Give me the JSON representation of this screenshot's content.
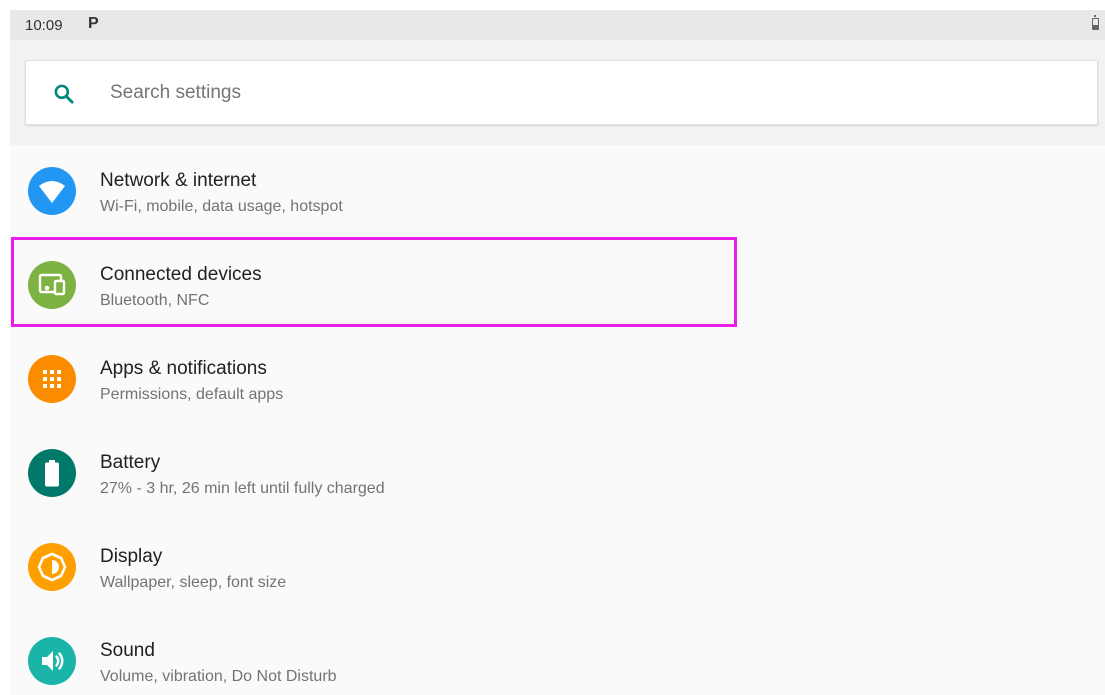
{
  "status_bar": {
    "time": "10:09",
    "notification_glyph": "P"
  },
  "search": {
    "placeholder": "Search settings"
  },
  "settings": [
    {
      "title": "Network & internet",
      "subtitle": "Wi-Fi, mobile, data usage, hotspot",
      "icon": "wifi-icon",
      "color": "#2196f3"
    },
    {
      "title": "Connected devices",
      "subtitle": "Bluetooth, NFC",
      "icon": "devices-icon",
      "color": "#7cb342"
    },
    {
      "title": "Apps & notifications",
      "subtitle": "Permissions, default apps",
      "icon": "apps-icon",
      "color": "#fb8c00"
    },
    {
      "title": "Battery",
      "subtitle": "27% - 3 hr, 26 min left until fully charged",
      "icon": "battery-icon",
      "color": "#00796b"
    },
    {
      "title": "Display",
      "subtitle": "Wallpaper, sleep, font size",
      "icon": "brightness-icon",
      "color": "#ffa000"
    },
    {
      "title": "Sound",
      "subtitle": "Volume, vibration, Do Not Disturb",
      "icon": "volume-icon",
      "color": "#1ab5a8"
    }
  ],
  "highlight_color": "#e91ee9"
}
